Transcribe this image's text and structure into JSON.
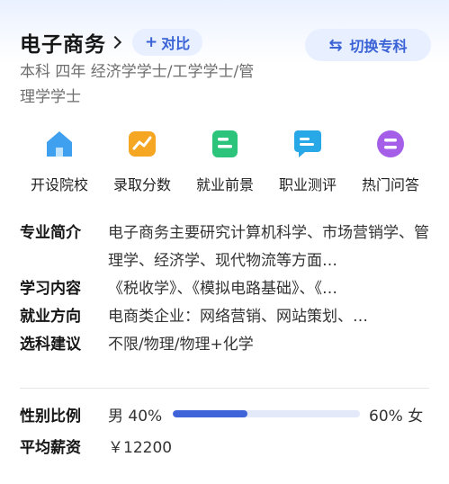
{
  "header": {
    "major_title": "电子商务",
    "compare_label": "对比",
    "compare_plus": "+",
    "switch_label": "切换专科",
    "switch_icon": "⇆",
    "meta": "本科 四年 经济学学士/工学学士/管理学学士"
  },
  "nav": {
    "items": [
      {
        "label": "开设院校",
        "icon": "school-icon",
        "color": "#3fa0f0"
      },
      {
        "label": "录取分数",
        "icon": "score-chart-icon",
        "color": "#f5a623"
      },
      {
        "label": "就业前景",
        "icon": "employment-icon",
        "color": "#2cc47a"
      },
      {
        "label": "职业测评",
        "icon": "assessment-icon",
        "color": "#29a8e8"
      },
      {
        "label": "热门问答",
        "icon": "qa-icon",
        "color": "#a55ee8"
      }
    ]
  },
  "info": {
    "intro_key": "专业简介",
    "intro_val": "电子商务主要研究计算机科学、市场营销学、管理学、经济学、现代物流等方面…",
    "study_key": "学习内容",
    "study_val": "《税收学》、《模拟电路基础》、《…",
    "job_key": "就业方向",
    "job_val": "电商类企业：网络营销、网站策划、…",
    "subject_key": "选科建议",
    "subject_val": "不限/物理/物理+化学"
  },
  "gender": {
    "key": "性别比例",
    "male": "男 40%",
    "female": "60% 女",
    "male_ratio": 0.4
  },
  "salary": {
    "key": "平均薪资",
    "value": "￥12200"
  }
}
